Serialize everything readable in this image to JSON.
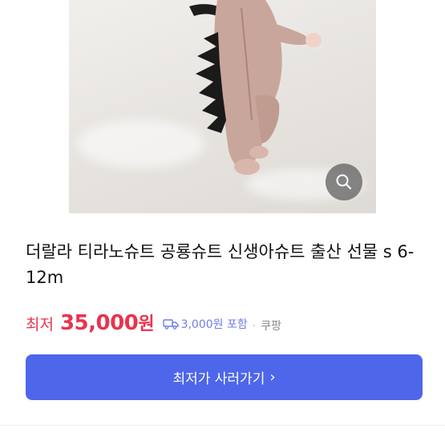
{
  "product": {
    "title": "더랄라 티라노슈트 공룡슈트 신생아슈트 출산 선물 s 6-12m",
    "image_alt": "baby in pink dinosaur suit lying on white sheet"
  },
  "zoom": {
    "icon": "magnifier-icon"
  },
  "price": {
    "prefix": "최저",
    "value": "35,000",
    "unit": "원",
    "shipping": "3,000원 포함",
    "shipping_icon": "delivery-truck-icon",
    "separator": "·",
    "seller": "쿠팡"
  },
  "cta": {
    "label": "최저가 사러가기",
    "chevron": "›"
  },
  "colors": {
    "price": "#e8344e",
    "shipping": "#6e7fe8",
    "button": "#4e66ea"
  }
}
